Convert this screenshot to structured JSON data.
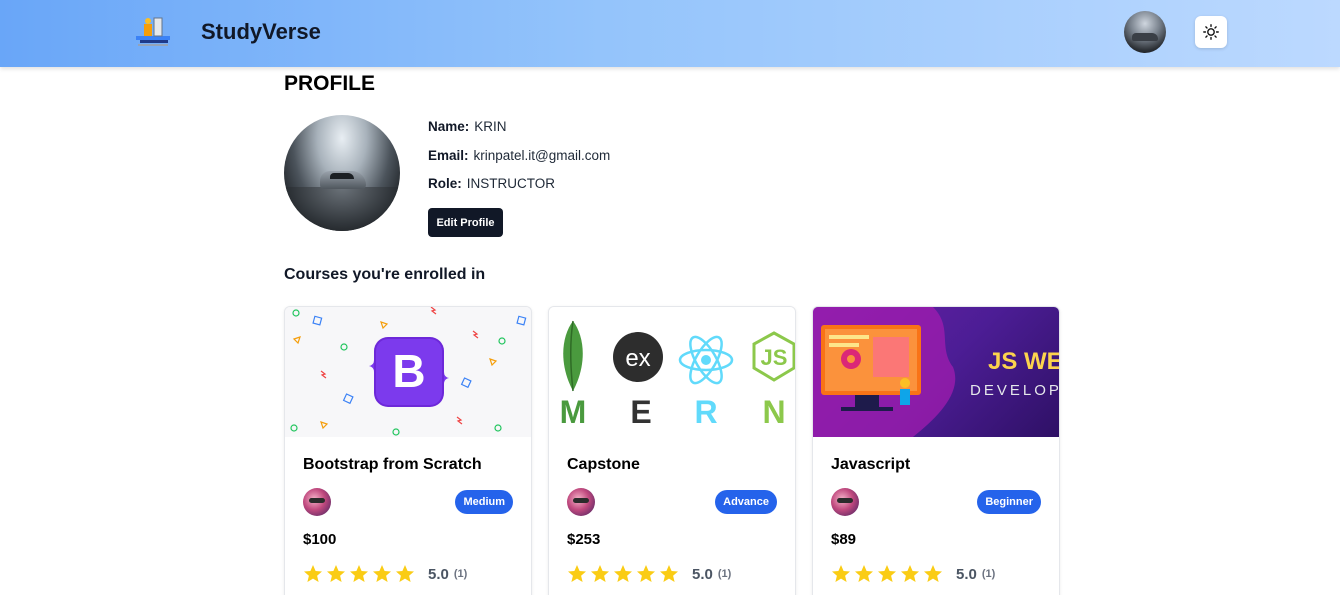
{
  "header": {
    "brand": "StudyVerse",
    "logo_icon": "study-logo-icon",
    "avatar_icon": "user-avatar",
    "theme_icon": "sun-icon"
  },
  "profile": {
    "title": "PROFILE",
    "name_label": "Name:",
    "name_value": "KRIN",
    "email_label": "Email:",
    "email_value": "krinpatel.it@gmail.com",
    "role_label": "Role:",
    "role_value": "INSTRUCTOR",
    "edit_button": "Edit Profile"
  },
  "courses": {
    "heading": "Courses you're enrolled in",
    "items": [
      {
        "title": "Bootstrap from Scratch",
        "level": "Medium",
        "price": "$100",
        "rating": "5.0",
        "count": "(1)",
        "thumbnail": "bootstrap-logo"
      },
      {
        "title": "Capstone",
        "level": "Advance",
        "price": "$253",
        "rating": "5.0",
        "count": "(1)",
        "thumbnail": "mern-stack",
        "thumb_text": [
          "M",
          "E",
          "R",
          "N"
        ],
        "ex_text": "ex"
      },
      {
        "title": "Javascript",
        "level": "Beginner",
        "price": "$89",
        "rating": "5.0",
        "count": "(1)",
        "thumbnail": "js-web-development",
        "thumb_title": "JS WE",
        "thumb_sub": "DEVELOPM"
      }
    ]
  },
  "colors": {
    "header_gradient_start": "#69a6f8",
    "header_gradient_end": "#bcd9ff",
    "badge": "#2563eb",
    "star": "#facc15",
    "button": "#111827"
  }
}
